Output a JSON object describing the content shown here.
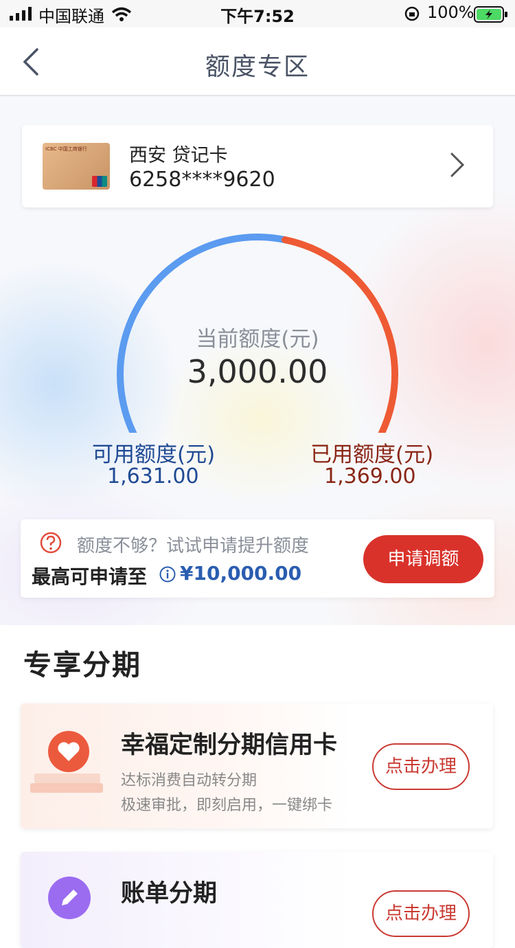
{
  "status_bar": {
    "carrier": "中国联通",
    "time": "下午7:52",
    "battery": "100%"
  },
  "nav": {
    "title": "额度专区"
  },
  "card": {
    "name": "西安 贷记卡",
    "number": "6258****9620"
  },
  "quota": {
    "current_label": "当前额度(元)",
    "current_value": "3,000.00",
    "available_label": "可用额度(元)",
    "available_value": "1,631.00",
    "used_label": "已用额度(元)",
    "used_value": "1,369.00",
    "available_fraction": 0.5437,
    "available_color": "#5b9bf0",
    "used_color": "#ee5a34"
  },
  "raise": {
    "prompt": "额度不够？试试申请提升额度",
    "max_label": "最高可申请至",
    "max_value": "¥10,000.00",
    "button": "申请调额"
  },
  "section": {
    "title": "专享分期"
  },
  "products": [
    {
      "title": "幸福定制分期信用卡",
      "subtitle_1": "达标消费自动转分期",
      "subtitle_2": "极速审批，即刻启用，一键绑卡",
      "button": "点击办理",
      "icon": "heart-icon"
    },
    {
      "title": "账单分期",
      "button": "点击办理",
      "icon": "pencil-icon"
    }
  ],
  "colors": {
    "accent_red": "#d9322b",
    "link_blue": "#2a5db0"
  }
}
